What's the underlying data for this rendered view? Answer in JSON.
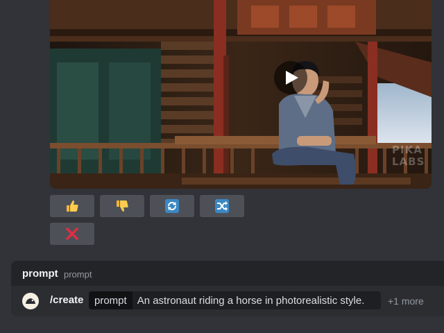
{
  "media": {
    "watermark_line1": "PIKA",
    "watermark_line2": "LABS"
  },
  "actions": {
    "thumbs_up": "👍",
    "thumbs_down": "👎",
    "regenerate": "🔄",
    "shuffle": "🔀",
    "cancel": "❌"
  },
  "command": {
    "title": "prompt",
    "description": "prompt",
    "slash": "/create",
    "option_name": "prompt",
    "option_value": "An astronaut riding a horse in photorealistic style.",
    "more": "+1 more"
  },
  "colors": {
    "background": "#313338",
    "button": "#4e5058",
    "panel": "#2b2d31",
    "panel_header": "#232428",
    "chip": "#1e1f22",
    "muted_text": "#949ba4"
  }
}
